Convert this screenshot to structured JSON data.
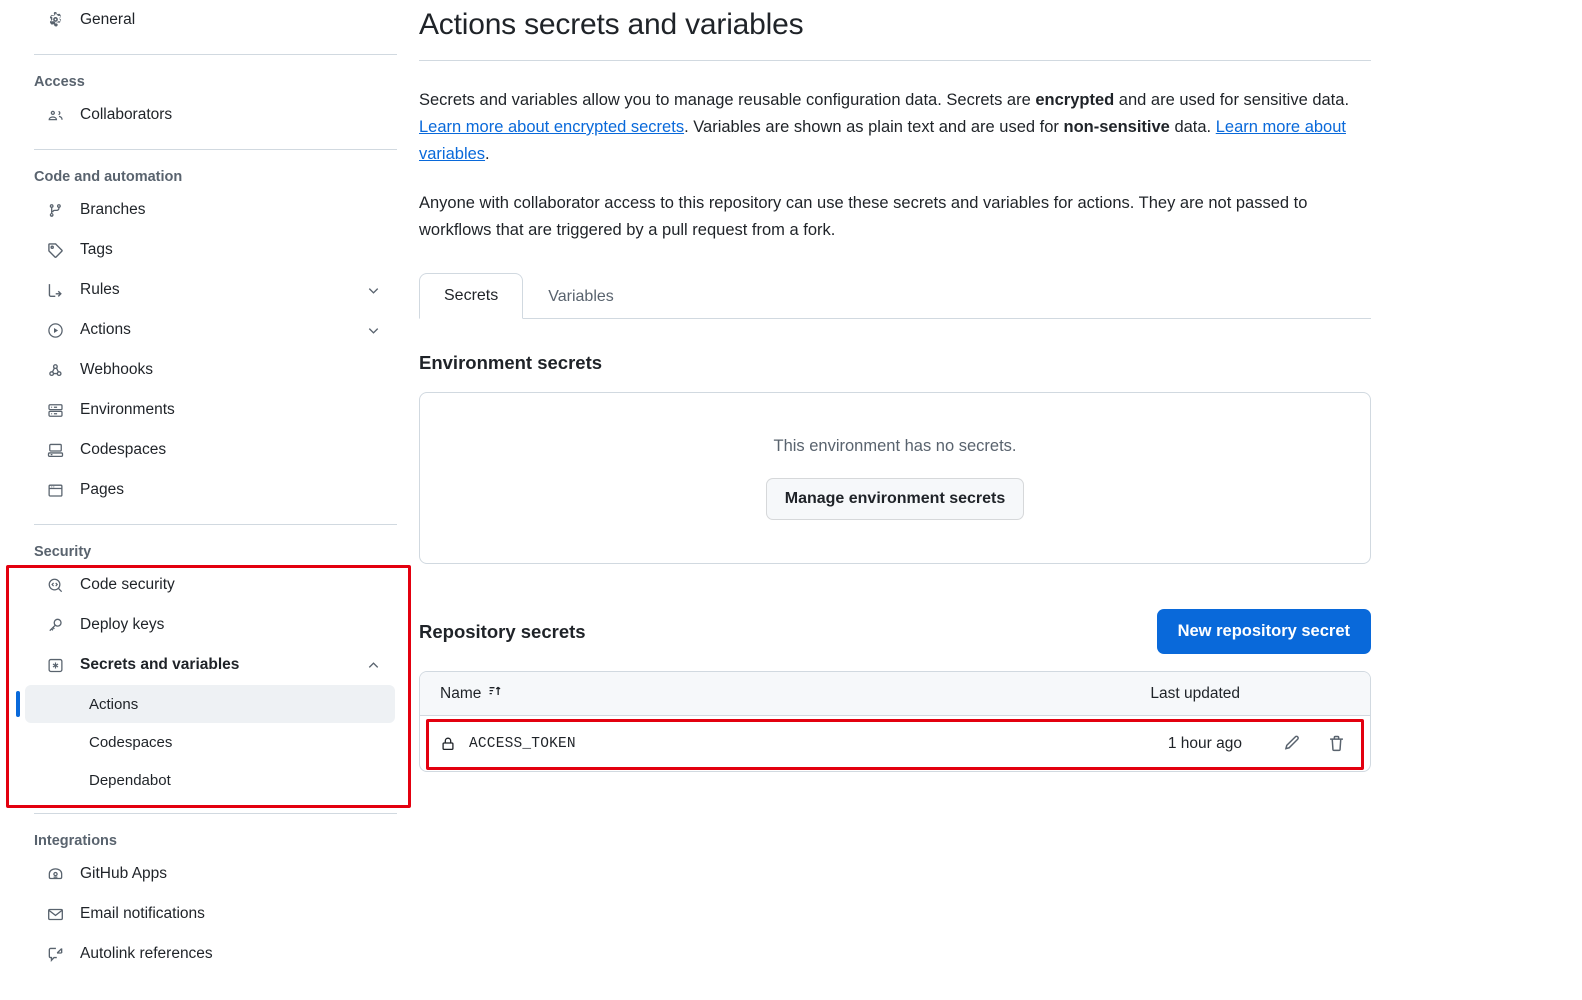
{
  "sidebar": {
    "top_items": [
      {
        "label": "General",
        "icon": "gear-icon"
      }
    ],
    "groups": [
      {
        "heading": "Access",
        "items": [
          {
            "label": "Collaborators",
            "icon": "people-icon"
          }
        ]
      },
      {
        "heading": "Code and automation",
        "items": [
          {
            "label": "Branches",
            "icon": "git-branch-icon"
          },
          {
            "label": "Tags",
            "icon": "tag-icon"
          },
          {
            "label": "Rules",
            "icon": "rules-icon",
            "chevron": "chevron-down-icon"
          },
          {
            "label": "Actions",
            "icon": "play-circle-icon",
            "chevron": "chevron-down-icon"
          },
          {
            "label": "Webhooks",
            "icon": "webhook-icon"
          },
          {
            "label": "Environments",
            "icon": "server-icon"
          },
          {
            "label": "Codespaces",
            "icon": "codespaces-icon"
          },
          {
            "label": "Pages",
            "icon": "browser-icon"
          }
        ]
      },
      {
        "heading": "Security",
        "items": [
          {
            "label": "Code security",
            "icon": "code-scan-icon"
          },
          {
            "label": "Deploy keys",
            "icon": "key-icon"
          },
          {
            "label": "Secrets and variables",
            "icon": "asterisk-box-icon",
            "chevron": "chevron-up-icon",
            "bold": true
          }
        ],
        "subitems": [
          {
            "label": "Actions",
            "selected": true
          },
          {
            "label": "Codespaces",
            "selected": false
          },
          {
            "label": "Dependabot",
            "selected": false
          }
        ]
      },
      {
        "heading": "Integrations",
        "items": [
          {
            "label": "GitHub Apps",
            "icon": "github-apps-icon"
          },
          {
            "label": "Email notifications",
            "icon": "mail-icon"
          },
          {
            "label": "Autolink references",
            "icon": "external-link-icon"
          }
        ]
      }
    ],
    "highlight_color": "#e3000f",
    "selection_color": "#0969da"
  },
  "main": {
    "title": "Actions secrets and variables",
    "description_1": {
      "part_1": "Secrets and variables allow you to manage reusable configuration data. Secrets are ",
      "bold_1": "encrypted",
      "part_2": " and are used for sensitive data. ",
      "link_1": "Learn more about encrypted secrets",
      "part_3": ". Variables are shown as plain text and are used for ",
      "bold_2": "non-sensitive",
      "part_4": " data. ",
      "link_2": "Learn more about variables",
      "part_5": "."
    },
    "description_2": "Anyone with collaborator access to this repository can use these secrets and variables for actions. They are not passed to workflows that are triggered by a pull request from a fork.",
    "tabs": [
      {
        "label": "Secrets",
        "active": true
      },
      {
        "label": "Variables",
        "active": false
      }
    ],
    "environment_secrets": {
      "heading": "Environment secrets",
      "empty_text": "This environment has no secrets.",
      "manage_button": "Manage environment secrets"
    },
    "repository_secrets": {
      "heading": "Repository secrets",
      "new_button": "New repository secret",
      "new_button_color": "#0969da",
      "columns": {
        "name": "Name",
        "sort_icon": "sort-ascending-icon",
        "last_updated": "Last updated"
      },
      "rows": [
        {
          "icon": "lock-icon",
          "name": "ACCESS_TOKEN",
          "last_updated": "1 hour ago",
          "edit_icon": "pencil-icon",
          "delete_icon": "trash-icon",
          "highlighted": true
        }
      ]
    }
  }
}
